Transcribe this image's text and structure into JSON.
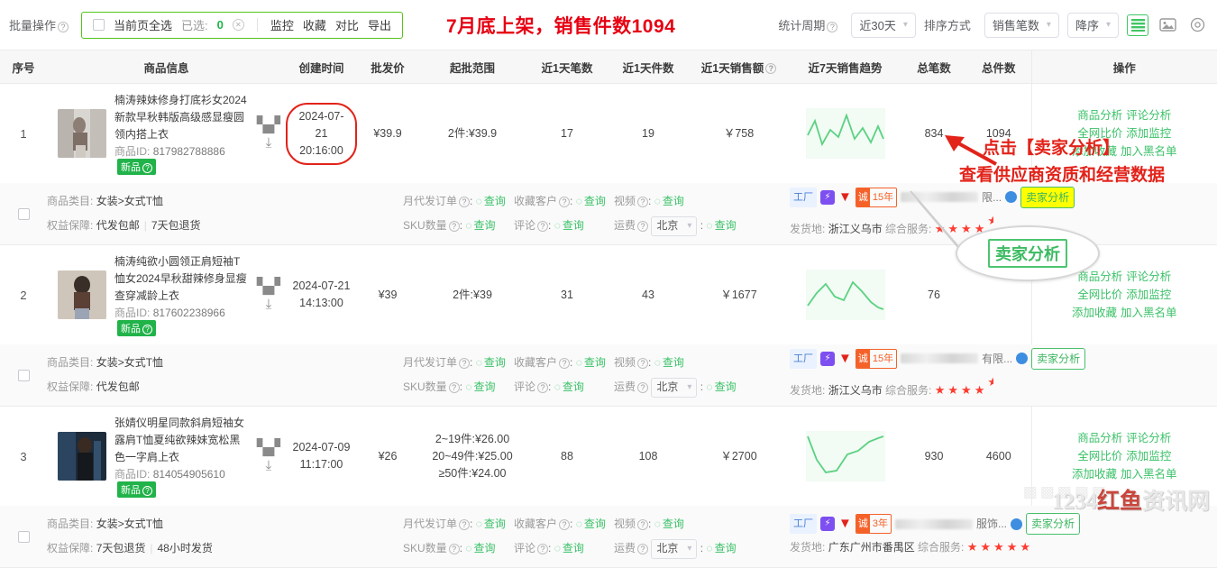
{
  "toolbar": {
    "batch_label": "批量操作",
    "select_all_label": "当前页全选",
    "selected_label": "已选:",
    "selected_count": "0",
    "actions": [
      "监控",
      "收藏",
      "对比",
      "导出"
    ],
    "banner": "7月底上架，销售件数1094",
    "period_label": "统计周期",
    "period_value": "近30天",
    "sort_label": "排序方式",
    "sort_value": "销售笔数",
    "order_value": "降序",
    "view_list_icon": "list-view-icon",
    "view_grid_icon": "image-view-icon",
    "settings_icon": "settings-icon"
  },
  "table": {
    "columns": [
      "序号",
      "商品信息",
      "创建时间",
      "批发价",
      "起批范围",
      "近1天笔数",
      "近1天件数",
      "近1天销售额",
      "近7天销售趋势",
      "总笔数",
      "总件数",
      "操作"
    ],
    "sales_amount_has_help": true,
    "op_links": [
      "商品分析",
      "评论分析",
      "全网比价",
      "添加监控",
      "添加收藏",
      "加入黑名单"
    ],
    "rows": [
      {
        "index": "1",
        "title": "楠涛辣妹修身打底衫女2024新款早秋韩版高级感显瘦圆领内搭上衣",
        "id_label": "商品ID:",
        "id": "817982788886",
        "tag": "新品",
        "create_date": "2024-07-21",
        "create_time": "20:16:00",
        "highlight_time": true,
        "price": "¥39.9",
        "moq": [
          "2件:¥39.9"
        ],
        "d1_orders": "17",
        "d1_items": "19",
        "d1_amount": "￥758",
        "total_orders": "834",
        "total_items": "1094",
        "sub": {
          "category_label": "商品类目:",
          "category": "女装>女式T恤",
          "rights_label": "权益保障:",
          "rights": [
            "代发包邮",
            "7天包退货"
          ],
          "monthly_label": "月代发订单",
          "sku_label": "SKU数量",
          "fav_label": "收藏客户",
          "comment_label": "评论",
          "video_label": "视频",
          "freight_label": "运费",
          "freight_city": "北京",
          "query_label": "查询",
          "badges": {
            "factory": "工厂",
            "years": "15年"
          },
          "shop_suffix": "限...",
          "seller_btn": "卖家分析",
          "seller_btn_highlight": true,
          "ship_label": "发货地:",
          "ship_from": "浙江义乌市",
          "service_label": "综合服务:",
          "stars": 4.5
        }
      },
      {
        "index": "2",
        "title": "楠涛纯欲小圆领正肩短袖T恤女2024早秋甜辣修身显瘦查穿减龄上衣",
        "id_label": "商品ID:",
        "id": "817602238966",
        "tag": "新品",
        "create_date": "2024-07-21",
        "create_time": "14:13:00",
        "highlight_time": false,
        "price": "¥39",
        "moq": [
          "2件:¥39"
        ],
        "d1_orders": "31",
        "d1_items": "43",
        "d1_amount": "￥1677",
        "total_orders": "76",
        "total_items": "",
        "sub": {
          "category_label": "商品类目:",
          "category": "女装>女式T恤",
          "rights_label": "权益保障:",
          "rights": [
            "代发包邮"
          ],
          "monthly_label": "月代发订单",
          "sku_label": "SKU数量",
          "fav_label": "收藏客户",
          "comment_label": "评论",
          "video_label": "视频",
          "freight_label": "运费",
          "freight_city": "北京",
          "query_label": "查询",
          "badges": {
            "factory": "工厂",
            "years": "15年"
          },
          "shop_suffix": "有限...",
          "seller_btn": "卖家分析",
          "seller_btn_highlight": false,
          "ship_label": "发货地:",
          "ship_from": "浙江义乌市",
          "service_label": "综合服务:",
          "stars": 4.5
        }
      },
      {
        "index": "3",
        "title": "张婧仪明星同款斜肩短袖女露肩T恤夏纯欲辣妹宽松黑色一字肩上衣",
        "id_label": "商品ID:",
        "id": "814054905610",
        "tag": "新品",
        "create_date": "2024-07-09",
        "create_time": "11:17:00",
        "highlight_time": false,
        "price": "¥26",
        "moq": [
          "2~19件:¥26.00",
          "20~49件:¥25.00",
          "≥50件:¥24.00"
        ],
        "d1_orders": "88",
        "d1_items": "108",
        "d1_amount": "￥2700",
        "total_orders": "930",
        "total_items": "4600",
        "sub": {
          "category_label": "商品类目:",
          "category": "女装>女式T恤",
          "rights_label": "权益保障:",
          "rights": [
            "7天包退货",
            "48小时发货"
          ],
          "monthly_label": "月代发订单",
          "sku_label": "SKU数量",
          "fav_label": "收藏客户",
          "comment_label": "评论",
          "video_label": "视频",
          "freight_label": "运费",
          "freight_city": "北京",
          "query_label": "查询",
          "badges": {
            "factory": "工厂",
            "years": "3年"
          },
          "shop_suffix": "服饰...",
          "seller_btn": "卖家分析",
          "seller_btn_highlight": false,
          "ship_label": "发货地:",
          "ship_from": "广东广州市番禺区",
          "service_label": "综合服务:",
          "stars": 5
        }
      }
    ]
  },
  "annotations": {
    "line1": "点击【卖家分析】",
    "line2": "查看供应商资质和经营数据",
    "bubble_text": "卖家分析"
  },
  "watermark": {
    "prefix": "1234",
    "highlight": "红鱼",
    "suffix": "资讯网"
  },
  "colors": {
    "accent": "#3bc168",
    "danger": "#e2231a",
    "header_bg": "#f7f7f7"
  }
}
